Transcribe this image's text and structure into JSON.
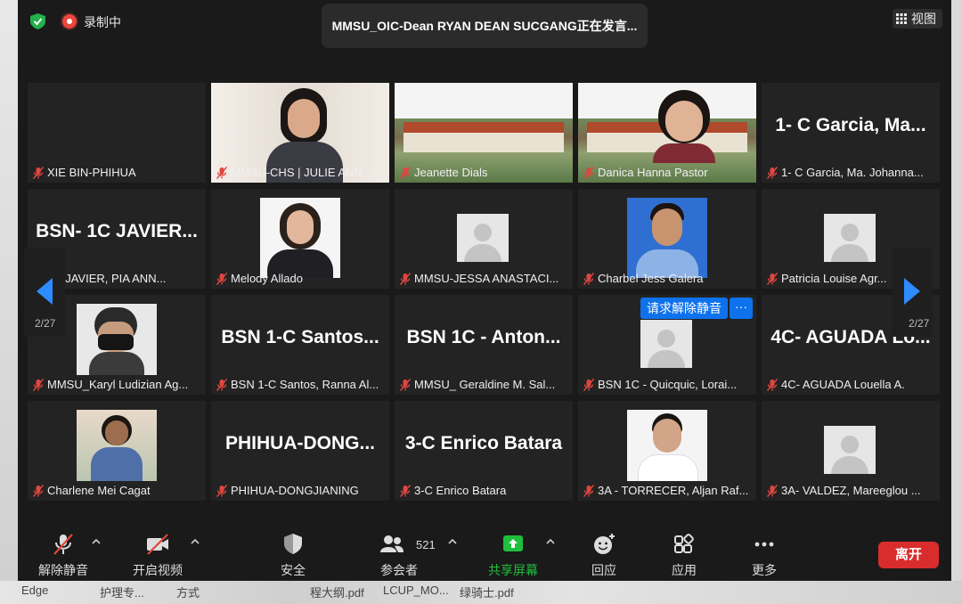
{
  "topbar": {
    "recording_label": "录制中",
    "speaker_banner": "MMSU_OIC-Dean RYAN DEAN SUCGANG正在发言...",
    "view_label": "视图"
  },
  "grid": {
    "page_left": "2/27",
    "page_right": "2/27",
    "tiles": [
      {
        "name": "XIE BIN-PHIHUA",
        "big": ""
      },
      {
        "name": "MMSU-CHS | JULIE ANN ...",
        "big": ""
      },
      {
        "name": "Jeanette Dials",
        "big": ""
      },
      {
        "name": "Danica Hanna Pastor",
        "big": ""
      },
      {
        "name": "1- C Garcia, Ma. Johanna...",
        "big": "1- C Garcia, Ma..."
      },
      {
        "name": "1C JAVIER, PIA ANN...",
        "big": "BSN- 1C JAVIER..."
      },
      {
        "name": "Melody Allado",
        "big": ""
      },
      {
        "name": "MMSU-JESSA ANASTACI...",
        "big": ""
      },
      {
        "name": "Charbel Jess Galera",
        "big": ""
      },
      {
        "name": "Patricia Louise Agr...",
        "big": ""
      },
      {
        "name": "MMSU_Karyl Ludizian Ag...",
        "big": ""
      },
      {
        "name": "BSN 1-C Santos, Ranna Al...",
        "big": "BSN 1-C Santos..."
      },
      {
        "name": "MMSU_ Geraldine M. Sal...",
        "big": "BSN 1C - Anton..."
      },
      {
        "name": "BSN 1C - Quicquic, Lorai...",
        "big": ""
      },
      {
        "name": "4C- AGUADA Louella A.",
        "big": "4C- AGUADA Lo..."
      },
      {
        "name": "Charlene Mei Cagat",
        "big": ""
      },
      {
        "name": "PHIHUA-DONGJIANING",
        "big": "PHIHUA-DONG..."
      },
      {
        "name": "3-C Enrico Batara",
        "big": "3-C Enrico Batara"
      },
      {
        "name": "3A - TORRECER, Aljan Raf...",
        "big": ""
      },
      {
        "name": "3A- VALDEZ, Mareeglou ...",
        "big": ""
      }
    ],
    "unmute_request": "请求解除静音",
    "more": "···"
  },
  "toolbar": {
    "mute": "解除静音",
    "video": "开启视频",
    "security": "安全",
    "participants": "参会者",
    "participants_count": "521",
    "share": "共享屏幕",
    "react": "回应",
    "apps": "应用",
    "more": "更多",
    "leave": "离开"
  },
  "taskbar": [
    "Edge",
    "护理专...",
    "方式",
    "程大纲.pdf",
    "LCUP_MO...",
    "绿骑士.pdf"
  ],
  "colors": {
    "accent": "#0e72ed",
    "leave": "#d92d2d",
    "share": "#1fbf3d",
    "mute_red": "#e0463f"
  }
}
